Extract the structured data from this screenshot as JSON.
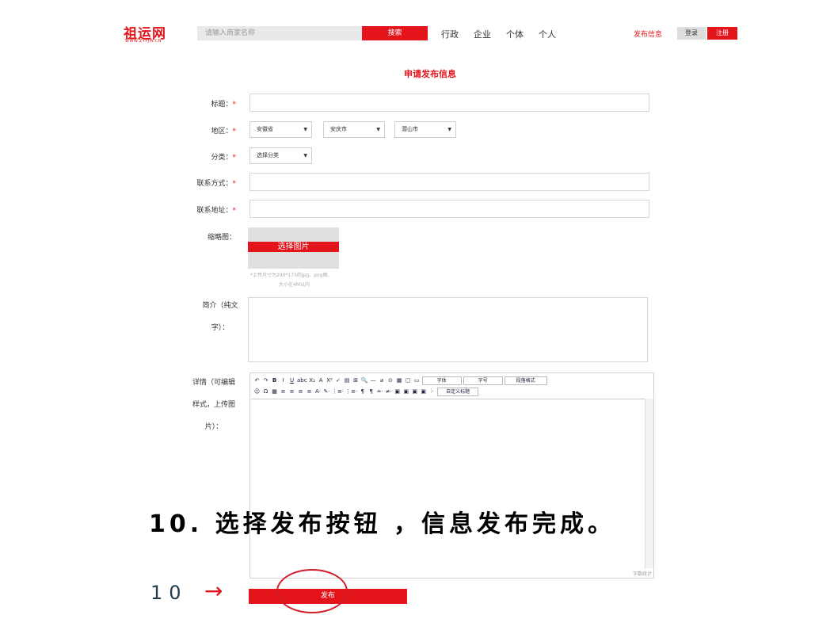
{
  "header": {
    "logo": "祖运网",
    "logo_sub": "WWW.ZYPJW.CN",
    "search_placeholder": "请输入商家名称",
    "search_button": "搜索",
    "nav": [
      "行政",
      "企业",
      "个体",
      "个人"
    ],
    "publish_link": "发布信息",
    "login": "登录",
    "register": "注册"
  },
  "page_title": "申请发布信息",
  "form": {
    "title_label": "标题：",
    "region_label": "地区：",
    "region_province": "安徽省",
    "region_city": "安庆市",
    "region_county": "潜山市",
    "category_label": "分类：",
    "category_value": "选择分类",
    "contact_label": "联系方式：",
    "address_label": "联系地址：",
    "thumb_label": "缩略图：",
    "thumb_button": "选择图片",
    "thumb_hint_1": "*上传尺寸为290*175的jpg、png图,",
    "thumb_hint_2": "大小在4M以内",
    "intro_label_1": "简介（纯文",
    "intro_label_2": "字）：",
    "detail_label_1": "详情（可编辑",
    "detail_label_2": "样式，上传图",
    "detail_label_3": "片）：",
    "required_mark": "*",
    "submit": "发布"
  },
  "editor": {
    "toolbar_row1": [
      "↶",
      "↷",
      "B",
      "I",
      "U",
      "abc",
      "X₂",
      "A",
      "X²",
      "✓",
      "▤",
      "⊞",
      "🔍",
      "—",
      "⌀",
      "⊙",
      "▦",
      "▢",
      "▭"
    ],
    "font_dropdown": "字体",
    "size_dropdown": "字号",
    "para_dropdown": "段落格式",
    "toolbar_row2": [
      "☺",
      "Ω",
      "▦",
      "≡",
      "≡",
      "≡",
      "≡",
      "A·",
      "✎·",
      "⋮≡·",
      "⋮≡·",
      "¶",
      "¶",
      "≐·",
      "≠·",
      "▣",
      "▣",
      "▣",
      "▣",
      "⫶·"
    ],
    "custom_title": "自定义标题",
    "word_count": "字数统计"
  },
  "annotation": {
    "caption": "10. 选择发布按钮 ，信息发布完成。",
    "step_number": "10",
    "arrow": "→"
  }
}
